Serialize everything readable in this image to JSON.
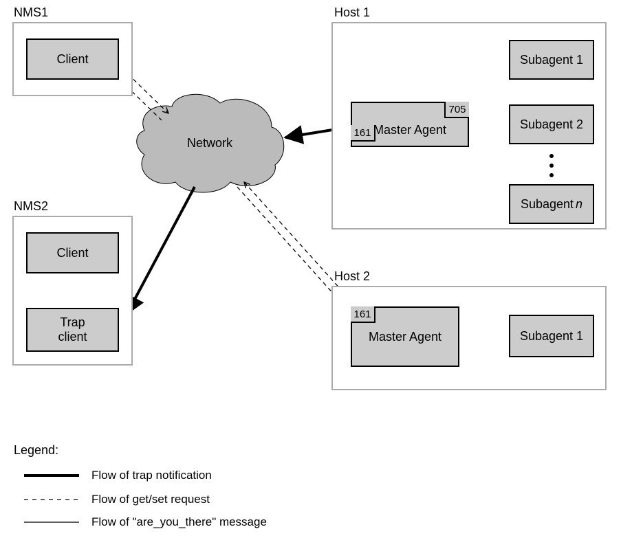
{
  "nms1": {
    "title": "NMS1",
    "client": "Client"
  },
  "nms2": {
    "title": "NMS2",
    "client": "Client",
    "trap": "Trap\nclient"
  },
  "host1": {
    "title": "Host 1",
    "master": "Master Agent",
    "port161": "161",
    "port705": "705",
    "sub1": "Subagent 1",
    "sub2": "Subagent 2",
    "subn": "Subagent n"
  },
  "host2": {
    "title": "Host 2",
    "master": "Master Agent",
    "port161": "161",
    "sub1": "Subagent 1"
  },
  "network": "Network",
  "legend": {
    "title": "Legend:",
    "trap": "Flow of trap notification",
    "getset": "Flow of get/set request",
    "ayt": "Flow of \"are_you_there\" message"
  },
  "subitalic_n": "n"
}
